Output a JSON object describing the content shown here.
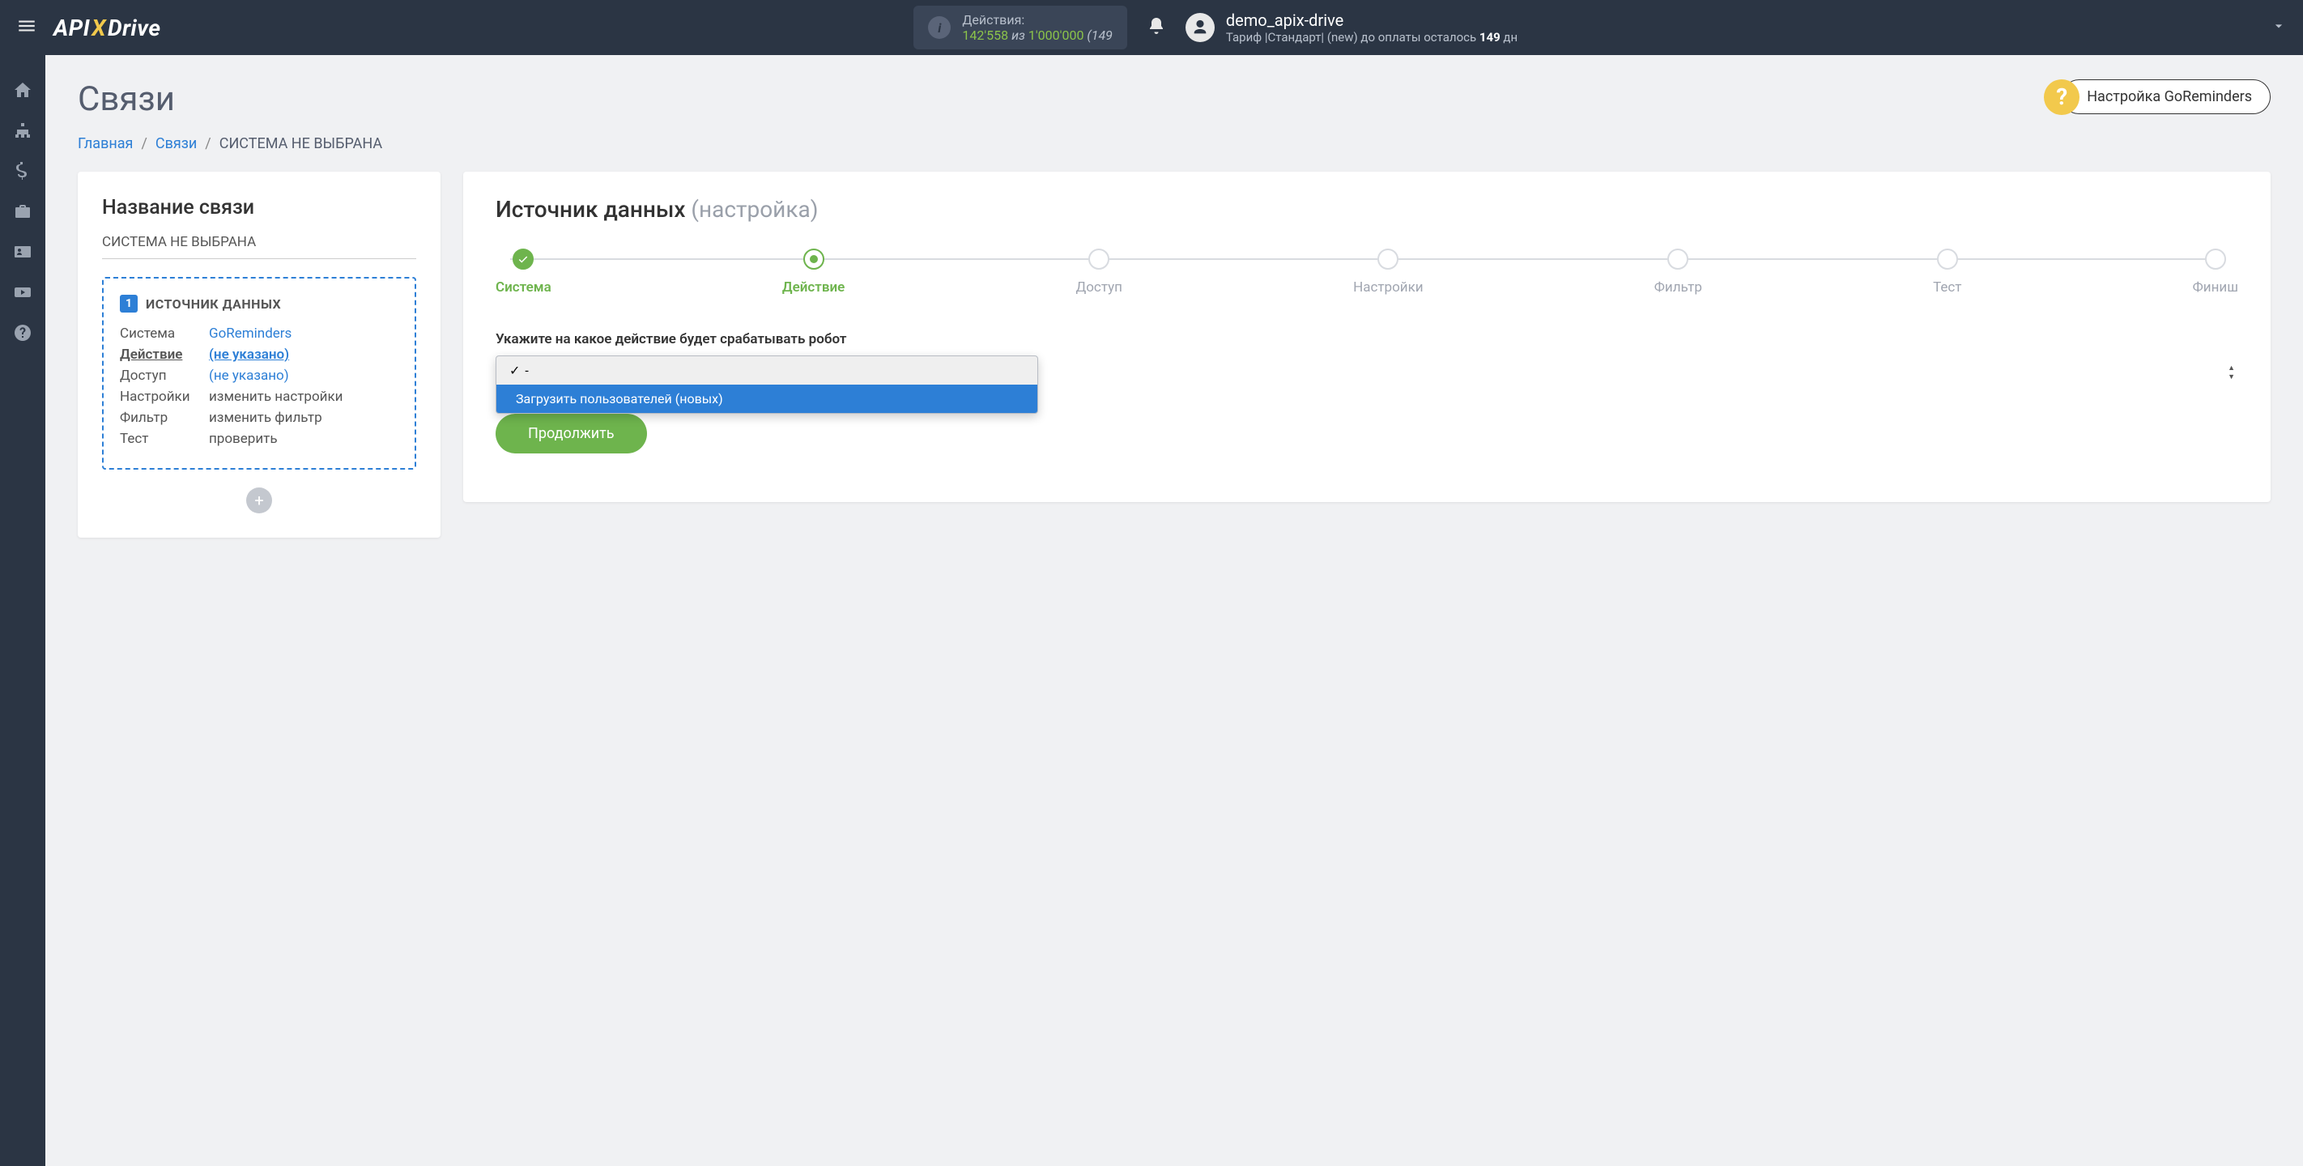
{
  "topbar": {
    "actions_label": "Действия:",
    "actions_count": "142'558",
    "actions_of": "из",
    "actions_total": "1'000'000",
    "actions_tail": "(149",
    "user_name": "demo_apix-drive",
    "plan_prefix": "Тариф |Стандарт| (new) до оплаты осталось ",
    "plan_days": "149",
    "plan_suffix": " дн"
  },
  "page": {
    "title": "Связи",
    "help_label": "Настройка GoReminders"
  },
  "breadcrumb": {
    "home": "Главная",
    "links": "Связи",
    "current": "СИСТЕМА НЕ ВЫБРАНА"
  },
  "left": {
    "title": "Название связи",
    "subtitle": "СИСТЕМА НЕ ВЫБРАНА",
    "box_badge": "1",
    "box_title": "ИСТОЧНИК ДАННЫХ",
    "rows": {
      "system_label": "Система",
      "system_value": "GoReminders",
      "action_label": "Действие",
      "action_value": "(не указано)",
      "access_label": "Доступ",
      "access_value": "(не указано)",
      "settings_label": "Настройки",
      "settings_value": "изменить настройки",
      "filter_label": "Фильтр",
      "filter_value": "изменить фильтр",
      "test_label": "Тест",
      "test_value": "проверить"
    }
  },
  "right": {
    "title": "Источник данных",
    "title_muted": "(настройка)",
    "steps": {
      "s1": "Система",
      "s2": "Действие",
      "s3": "Доступ",
      "s4": "Настройки",
      "s5": "Фильтр",
      "s6": "Тест",
      "s7": "Финиш"
    },
    "form_label": "Укажите на какое действие будет срабатывать робот",
    "dropdown": {
      "opt_selected": "-",
      "opt_highlighted": "Загрузить пользователей (новых)"
    },
    "continue": "Продолжить"
  }
}
